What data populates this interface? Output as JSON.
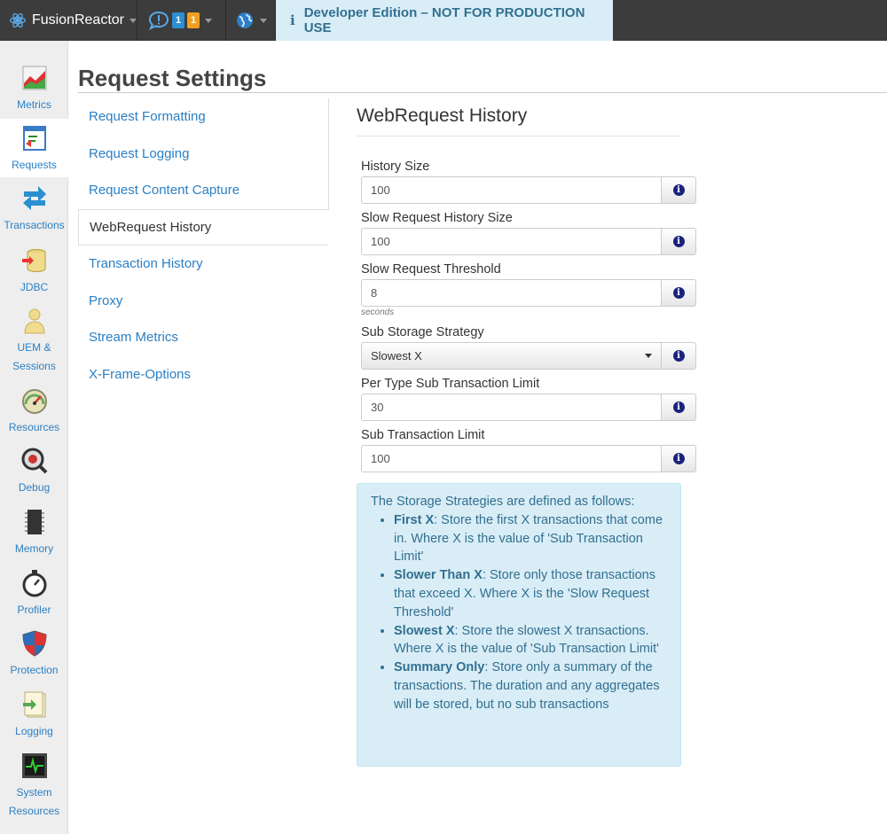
{
  "topbar": {
    "brand": "FusionReactor",
    "notifications": {
      "info_count": "1",
      "warning_count": "1"
    },
    "banner_icon": "i",
    "banner": "Developer Edition – NOT FOR PRODUCTION USE"
  },
  "sidebar": {
    "items": [
      {
        "label": "Metrics",
        "icon": "metrics-icon"
      },
      {
        "label": "Requests",
        "icon": "requests-icon"
      },
      {
        "label": "Transactions",
        "icon": "transactions-icon"
      },
      {
        "label": "JDBC",
        "icon": "jdbc-icon"
      },
      {
        "label": "UEM &",
        "label2": "Sessions",
        "icon": "uem-icon"
      },
      {
        "label": "Resources",
        "icon": "resources-icon"
      },
      {
        "label": "Debug",
        "icon": "debug-icon"
      },
      {
        "label": "Memory",
        "icon": "memory-icon"
      },
      {
        "label": "Profiler",
        "icon": "profiler-icon"
      },
      {
        "label": "Protection",
        "icon": "protection-icon"
      },
      {
        "label": "Logging",
        "icon": "logging-icon"
      },
      {
        "label": "System",
        "label2": "Resources",
        "icon": "system-resources-icon"
      }
    ]
  },
  "page": {
    "title": "Request Settings"
  },
  "subnav": {
    "items": [
      "Request Formatting",
      "Request Logging",
      "Request Content Capture",
      "WebRequest History",
      "Transaction History",
      "Proxy",
      "Stream Metrics",
      "X-Frame-Options"
    ],
    "active": "WebRequest History"
  },
  "section": {
    "title": "WebRequest History",
    "fields": {
      "history_size": {
        "label": "History Size",
        "value": "100"
      },
      "slow_history_size": {
        "label": "Slow Request History Size",
        "value": "100"
      },
      "slow_threshold": {
        "label": "Slow Request Threshold",
        "value": "8",
        "help": "seconds"
      },
      "sub_storage": {
        "label": "Sub Storage Strategy",
        "value": "Slowest X"
      },
      "per_type_limit": {
        "label": "Per Type Sub Transaction Limit",
        "value": "30"
      },
      "sub_limit": {
        "label": "Sub Transaction Limit",
        "value": "100"
      }
    },
    "info_glyph": "i"
  },
  "infobox": {
    "intro": "The Storage Strategies are defined as follows:",
    "items": [
      {
        "term": "First X",
        "desc": ": Store the first X transactions that come in. Where X is the value of 'Sub Transaction Limit'"
      },
      {
        "term": "Slower Than X",
        "desc": ": Store only those transactions that exceed X. Where X is the 'Slow Request Threshold'"
      },
      {
        "term": "Slowest X",
        "desc": ": Store the slowest X transactions. Where X is the value of 'Sub Transaction Limit'"
      },
      {
        "term": "Summary Only",
        "desc": ": Store only a summary of the transactions. The duration and any aggregates will be stored, but no sub transactions"
      }
    ]
  },
  "colors": {
    "accent": "#2b7fc3",
    "banner_bg": "#d9edf7",
    "banner_text": "#31708f",
    "topbar_bg": "#3c3c3c"
  }
}
